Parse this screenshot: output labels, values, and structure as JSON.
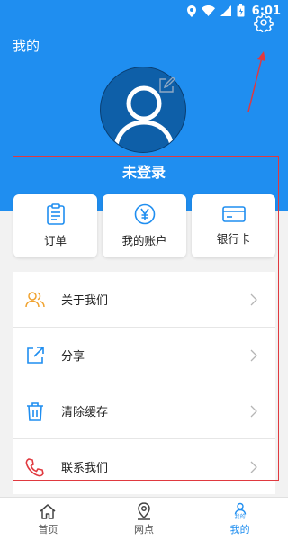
{
  "status_bar": {
    "time": "6:01"
  },
  "header": {
    "title": "我的"
  },
  "profile": {
    "status": "未登录"
  },
  "cards": [
    {
      "label": "订单",
      "icon": "clipboard-icon"
    },
    {
      "label": "我的账户",
      "icon": "yen-circle-icon"
    },
    {
      "label": "银行卡",
      "icon": "bank-card-icon"
    }
  ],
  "menu": [
    {
      "label": "关于我们",
      "icon": "users-icon"
    },
    {
      "label": "分享",
      "icon": "share-icon"
    },
    {
      "label": "清除缓存",
      "icon": "trash-icon"
    },
    {
      "label": "联系我们",
      "icon": "phone-icon"
    }
  ],
  "nav": [
    {
      "label": "首页",
      "icon": "home-icon",
      "active": false
    },
    {
      "label": "网点",
      "icon": "location-pin-icon",
      "active": false
    },
    {
      "label": "我的",
      "mini_label": "我的",
      "icon": "user-icon",
      "active": true
    }
  ],
  "colors": {
    "primary": "#1f8ef0",
    "avatar_bg": "#0e5fa8",
    "annotation": "#e0393f",
    "icon_orange": "#f0a22e",
    "icon_blue": "#1f8ef0"
  }
}
